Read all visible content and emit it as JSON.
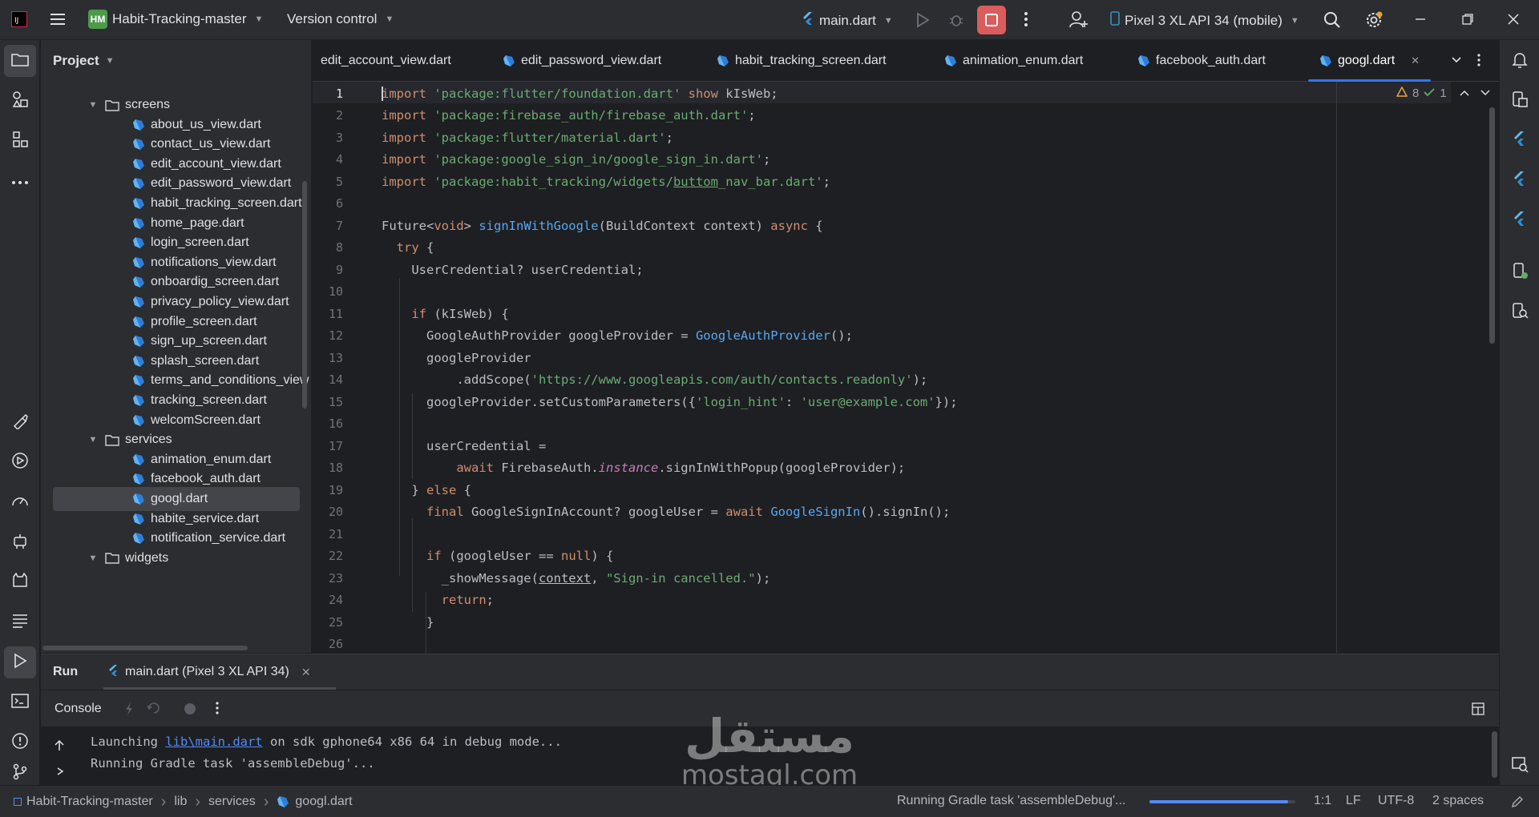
{
  "titlebar": {
    "project_badge": "HM",
    "project_name": "Habit-Tracking-master",
    "vcs": "Version control",
    "run_config": "main.dart",
    "device": "Pixel 3 XL API 34 (mobile)"
  },
  "project_panel": {
    "title": "Project",
    "tree": [
      {
        "label": "screens",
        "kind": "folder",
        "expanded": true
      },
      {
        "label": "about_us_view.dart",
        "kind": "file"
      },
      {
        "label": "contact_us_view.dart",
        "kind": "file"
      },
      {
        "label": "edit_account_view.dart",
        "kind": "file"
      },
      {
        "label": "edit_password_view.dart",
        "kind": "file"
      },
      {
        "label": "habit_tracking_screen.dart",
        "kind": "file"
      },
      {
        "label": "home_page.dart",
        "kind": "file"
      },
      {
        "label": "login_screen.dart",
        "kind": "file"
      },
      {
        "label": "notifications_view.dart",
        "kind": "file"
      },
      {
        "label": "onboardig_screen.dart",
        "kind": "file"
      },
      {
        "label": "privacy_policy_view.dart",
        "kind": "file"
      },
      {
        "label": "profile_screen.dart",
        "kind": "file"
      },
      {
        "label": "sign_up_screen.dart",
        "kind": "file"
      },
      {
        "label": "splash_screen.dart",
        "kind": "file"
      },
      {
        "label": "terms_and_conditions_view",
        "kind": "file"
      },
      {
        "label": "tracking_screen.dart",
        "kind": "file"
      },
      {
        "label": "welcomScreen.dart",
        "kind": "file"
      },
      {
        "label": "services",
        "kind": "folder",
        "expanded": true
      },
      {
        "label": "animation_enum.dart",
        "kind": "file"
      },
      {
        "label": "facebook_auth.dart",
        "kind": "file"
      },
      {
        "label": "googl.dart",
        "kind": "file",
        "selected": true
      },
      {
        "label": "habite_service.dart",
        "kind": "file"
      },
      {
        "label": "notification_service.dart",
        "kind": "file"
      },
      {
        "label": "widgets",
        "kind": "folder",
        "expanded": true
      }
    ]
  },
  "editor": {
    "tabs": [
      {
        "label": "edit_account_view.dart",
        "icon": false
      },
      {
        "label": "edit_password_view.dart",
        "icon": true
      },
      {
        "label": "habit_tracking_screen.dart",
        "icon": true
      },
      {
        "label": "animation_enum.dart",
        "icon": true
      },
      {
        "label": "facebook_auth.dart",
        "icon": true
      },
      {
        "label": "googl.dart",
        "icon": true,
        "active": true
      }
    ],
    "warnings": "8",
    "weak_warnings": "1",
    "line_numbers": [
      "1",
      "2",
      "3",
      "4",
      "5",
      "6",
      "7",
      "8",
      "9",
      "10",
      "11",
      "12",
      "13",
      "14",
      "15",
      "16",
      "17",
      "18",
      "19",
      "20",
      "21",
      "22",
      "23",
      "24",
      "25",
      "26"
    ]
  },
  "run_panel": {
    "title": "Run",
    "config_tab": "main.dart (Pixel 3 XL API 34)",
    "console_tab": "Console",
    "line1_a": "Launching ",
    "line1_link": "lib\\main.dart",
    "line1_b": " on sdk gphone64 x86 64 in debug mode...",
    "line2": "Running Gradle task 'assembleDebug'..."
  },
  "statusbar": {
    "breadcrumb": [
      "Habit-Tracking-master",
      "lib",
      "services",
      "googl.dart"
    ],
    "task": "Running Gradle task 'assembleDebug'...",
    "task_progress": 0.95,
    "position": "1:1",
    "line_sep": "LF",
    "encoding": "UTF-8",
    "indent": "2 spaces"
  },
  "watermark": {
    "arabic": "مستقل",
    "latin": "mostaql.com"
  }
}
